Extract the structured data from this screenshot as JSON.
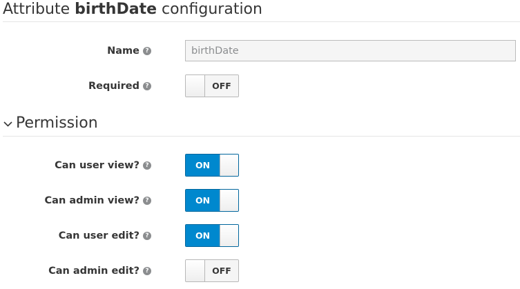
{
  "header": {
    "title_prefix": "Attribute",
    "title_name": "birthDate",
    "title_suffix": "configuration"
  },
  "fields": {
    "name": {
      "label": "Name",
      "value": "birthDate"
    },
    "required": {
      "label": "Required",
      "state": "OFF"
    }
  },
  "permission": {
    "title": "Permission",
    "user_view": {
      "label": "Can user view?",
      "state": "ON"
    },
    "admin_view": {
      "label": "Can admin view?",
      "state": "ON"
    },
    "user_edit": {
      "label": "Can user edit?",
      "state": "ON"
    },
    "admin_edit": {
      "label": "Can admin edit?",
      "state": "OFF"
    }
  },
  "icons": {
    "help": "question-circle-icon",
    "chevron": "chevron-down-icon"
  },
  "colors": {
    "on_blue": "#0088ce",
    "text": "#363636",
    "help_gray": "#8b8d8f"
  }
}
